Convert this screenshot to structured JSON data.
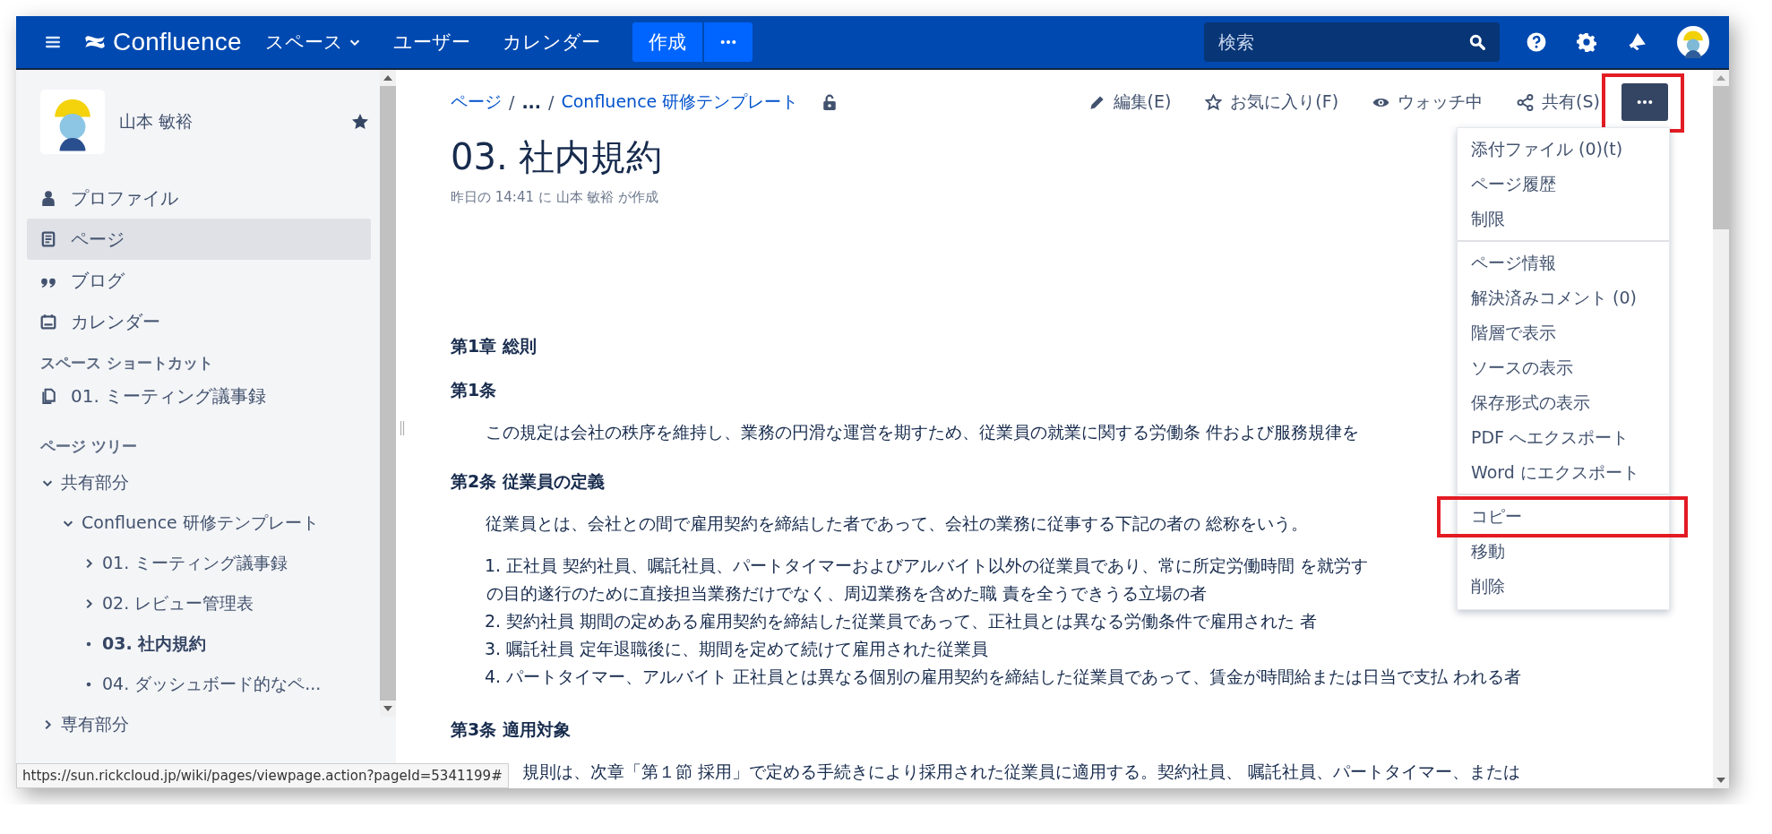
{
  "top_nav": {
    "logo": "Confluence",
    "items": [
      {
        "label": "スペース",
        "dropdown": true
      },
      {
        "label": "ユーザー",
        "dropdown": false
      },
      {
        "label": "カレンダー",
        "dropdown": false
      }
    ],
    "create_button": "作成",
    "search": {
      "placeholder": "検索"
    }
  },
  "sidebar": {
    "space_name": "山本 敏裕",
    "starred": true,
    "nav": [
      {
        "label": "プロファイル",
        "kind": "profile",
        "selected": false
      },
      {
        "label": "ページ",
        "kind": "pages",
        "selected": true
      },
      {
        "label": "ブログ",
        "kind": "blog",
        "selected": false
      },
      {
        "label": "カレンダー",
        "kind": "calendar",
        "selected": false
      }
    ],
    "shortcuts_heading": "スペース ショートカット",
    "shortcuts": [
      {
        "label": "01. ミーティング議事録"
      }
    ],
    "tree_heading": "ページ ツリー",
    "tree": [
      {
        "label": "共有部分",
        "kind": "branch",
        "expanded": true,
        "selected": false,
        "children": [
          {
            "label": "Confluence 研修テンプレート",
            "kind": "branch",
            "expanded": true,
            "selected": false,
            "children": [
              {
                "label": "01. ミーティング議事録",
                "kind": "branch",
                "expanded": false,
                "selected": false
              },
              {
                "label": "02. レビュー管理表",
                "kind": "branch",
                "expanded": false,
                "selected": false
              },
              {
                "label": "03. 社内規約",
                "kind": "leaf",
                "selected": true
              },
              {
                "label": "04. ダッシュボード的なペ...",
                "kind": "leaf",
                "selected": false
              }
            ]
          }
        ]
      },
      {
        "label": "専有部分",
        "kind": "branch",
        "expanded": false,
        "selected": false
      }
    ]
  },
  "page": {
    "breadcrumb_separator": "/",
    "breadcrumb": [
      {
        "label": "ページ",
        "kind": "link"
      },
      {
        "label": "...",
        "kind": "ellipsis"
      },
      {
        "label": "Confluence 研修テンプレート",
        "kind": "link"
      }
    ],
    "actions": [
      {
        "label": "編集(E)",
        "kind": "edit"
      },
      {
        "label": "お気に入り(F)",
        "kind": "favorite"
      },
      {
        "label": "ウォッチ中",
        "kind": "watch"
      },
      {
        "label": "共有(S)",
        "kind": "share"
      }
    ],
    "more_button": {
      "highlighted": true
    },
    "title": "03. 社内規約",
    "byline": "昨日の 14:41 に 山本 敏裕 が作成",
    "body": [
      {
        "kind": "chapter",
        "text": "第1章 総則"
      },
      {
        "kind": "article",
        "text": "第1条"
      },
      {
        "kind": "para",
        "text": "この規定は会社の秩序を維持し、業務の円滑な運営を期すため、従業員の就業に関する労働条 件および服務規律を"
      },
      {
        "kind": "article",
        "text": "第2条 従業員の定義"
      },
      {
        "kind": "para",
        "text": "従業員とは、会社との間で雇用契約を締結した者であって、会社の業務に従事する下記の者の 総称をいう。"
      },
      {
        "kind": "list",
        "items": [
          {
            "number": "1.",
            "lines": [
              "正社員 契約社員、嘱託社員、パートタイマーおよびアルバイト以外の従業員であり、常に所定労働時間 を就労す",
              "の目的遂行のために直接担当業務だけでなく、周辺業務を含めた職 責を全うできうる立場の者"
            ]
          },
          {
            "number": "2.",
            "lines": [
              "契約社員 期間の定めある雇用契約を締結した従業員であって、正社員とは異なる労働条件で雇用された 者"
            ]
          },
          {
            "number": "3.",
            "lines": [
              "嘱託社員 定年退職後に、期間を定めて続けて雇用された従業員"
            ]
          },
          {
            "number": "4.",
            "lines": [
              "パートタイマー、アルバイト 正社員とは異なる個別の雇用契約を締結した従業員であって、賃金が時間給または日当で支払 われる者"
            ]
          }
        ]
      },
      {
        "kind": "article",
        "text": "第3条 適用対象"
      },
      {
        "kind": "para_covered",
        "text": "規則は、次章「第１節 採用」で定める手続きにより採用された従業員に適用する。契約社員、 嘱託社員、パートタイマー、または"
      }
    ]
  },
  "menu": {
    "groups": [
      [
        {
          "label": "添付ファイル (0)(t)",
          "highlighted": false
        },
        {
          "label": "ページ履歴",
          "highlighted": false
        },
        {
          "label": "制限",
          "highlighted": false
        }
      ],
      [
        {
          "label": "ページ情報",
          "highlighted": false
        },
        {
          "label": "解決済みコメント (0)",
          "highlighted": false
        },
        {
          "label": "階層で表示",
          "highlighted": false
        },
        {
          "label": "ソースの表示",
          "highlighted": false
        },
        {
          "label": "保存形式の表示",
          "highlighted": false
        },
        {
          "label": "PDF へエクスポート",
          "highlighted": false
        },
        {
          "label": "Word にエクスポート",
          "highlighted": false
        }
      ],
      [
        {
          "label": "コピー",
          "highlighted": true
        },
        {
          "label": "移動",
          "highlighted": false
        },
        {
          "label": "削除",
          "highlighted": false
        }
      ]
    ]
  },
  "status_url": "https://sun.rickcloud.jp/wiki/pages/viewpage.action?pageId=5341199#"
}
